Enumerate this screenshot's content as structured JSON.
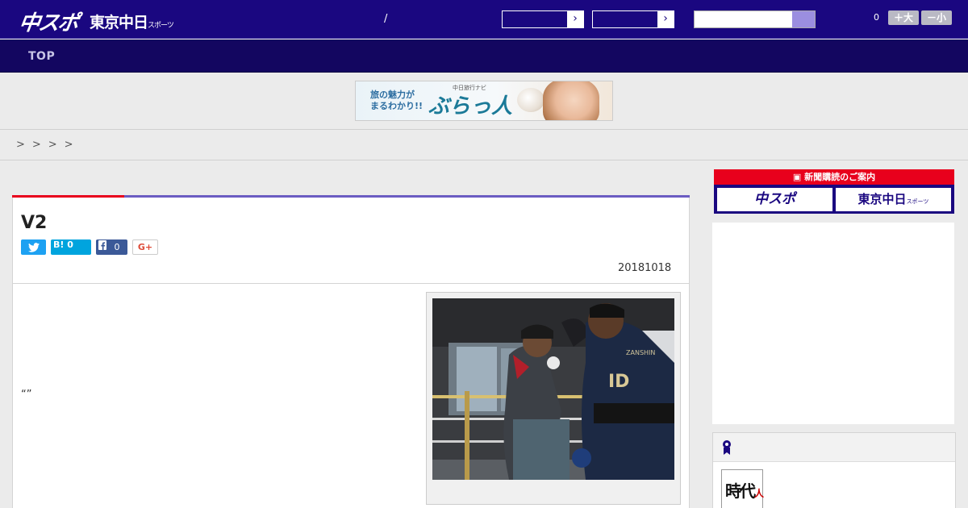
{
  "header": {
    "logo_chuspo": "中スポ",
    "logo_tokyo": "東京中日",
    "logo_tokyo_sub": "スポーツ",
    "slash": "/",
    "select_arrow": "›",
    "font_count": "0",
    "font_larger": "＋大",
    "font_smaller": "－小"
  },
  "nav": {
    "top": "TOP"
  },
  "banner_ad": {
    "line1": "旅の魅力が",
    "line2": "まるわかり!!",
    "small": "中日旅行ナビ",
    "brand": "ぶらっ人"
  },
  "breadcrumb": ">>>>",
  "article": {
    "title": "V2",
    "hatena_badge": "B!",
    "hatena_count": "0",
    "facebook_count": "0",
    "gplus_label": "G+",
    "date": "20181018",
    "body_quote": "“”"
  },
  "sidebar": {
    "promo_header": "新聞購読のご案内",
    "promo_chuspo": "中スポ",
    "promo_tokyo": "東京中日",
    "promo_tokyo_sub": "スポーツ",
    "thumb_text": "時代",
    "thumb_sub": "人"
  },
  "colors": {
    "header_bg": "#1a0780",
    "nav_bg": "#130660",
    "accent_red": "#e8001c",
    "accent_purple": "#6b5cc2"
  },
  "icons": [
    "twitter-icon",
    "hatena-bookmark-icon",
    "facebook-icon",
    "google-plus-icon",
    "search-icon",
    "ribbon-icon",
    "newspaper-icon"
  ]
}
